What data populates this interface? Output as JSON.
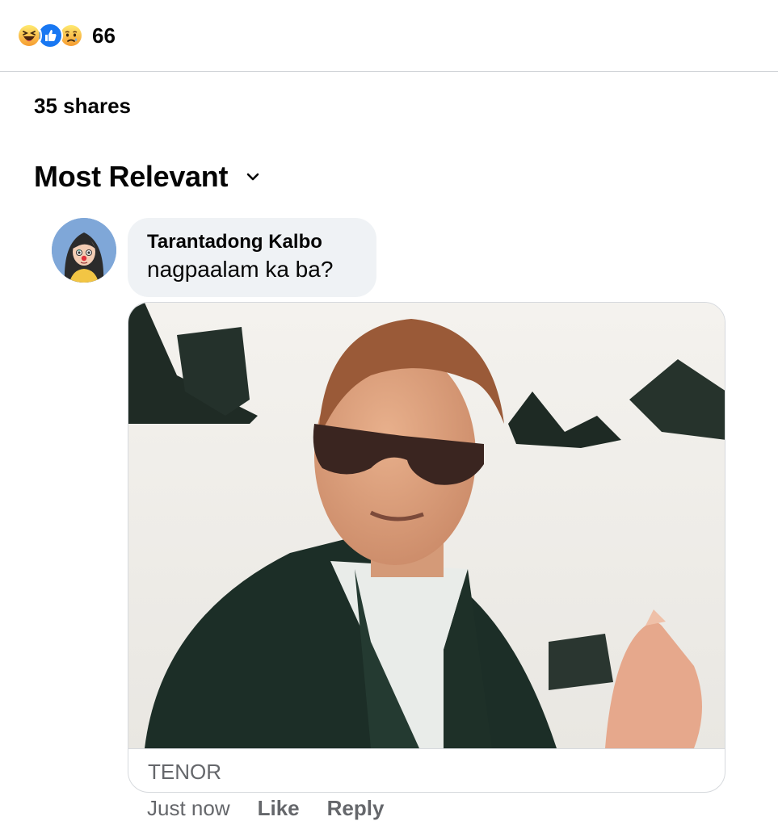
{
  "reactions": {
    "icons": [
      "haha-icon",
      "like-icon",
      "sad-icon"
    ],
    "count": "66",
    "colors": {
      "like": "#1877f2",
      "haha": "#f7b125"
    }
  },
  "shares": "35 shares",
  "sort": {
    "label": "Most Relevant",
    "icon": "chevron-down-icon"
  },
  "comment": {
    "author": "Tarantadong Kalbo",
    "text": "nagpaalam ka ba?",
    "attachment": {
      "source": "TENOR"
    },
    "time": "Just now",
    "like_label": "Like",
    "reply_label": "Reply"
  }
}
